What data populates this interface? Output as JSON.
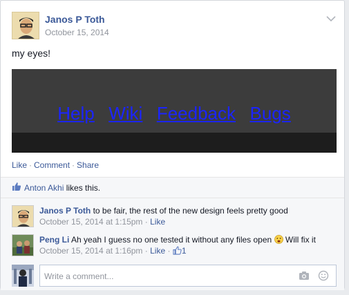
{
  "post": {
    "author": "Janos P Toth",
    "date": "October 15, 2014",
    "text": "my eyes!",
    "image_links": [
      "Help",
      "Wiki",
      "Feedback",
      "Bugs"
    ]
  },
  "actions": {
    "like": "Like",
    "comment": "Comment",
    "share": "Share",
    "separator": "·"
  },
  "likes": {
    "liker": "Anton Akhi",
    "suffix": "likes this."
  },
  "comments": [
    {
      "author": "Janos P Toth",
      "text": "to be fair, the rest of the new design feels pretty good",
      "time": "October 15, 2014 at 1:15pm",
      "like": "Like"
    },
    {
      "author": "Peng Li",
      "text": "Ah yeah I guess no one tested it without any files open",
      "text_after_emoji": "Will fix it",
      "time": "October 15, 2014 at 1:16pm",
      "like": "Like",
      "like_count": "1"
    }
  ],
  "composer": {
    "placeholder": "Write a comment..."
  },
  "colors": {
    "link": "#3b5998",
    "meta": "#90949c",
    "image_bg": "#3c3c3c",
    "image_link": "#1b24ff"
  },
  "icons": [
    "chevron-down-icon",
    "thumbs-up-icon",
    "camera-icon",
    "smiley-icon",
    "worried-emoji-icon"
  ]
}
